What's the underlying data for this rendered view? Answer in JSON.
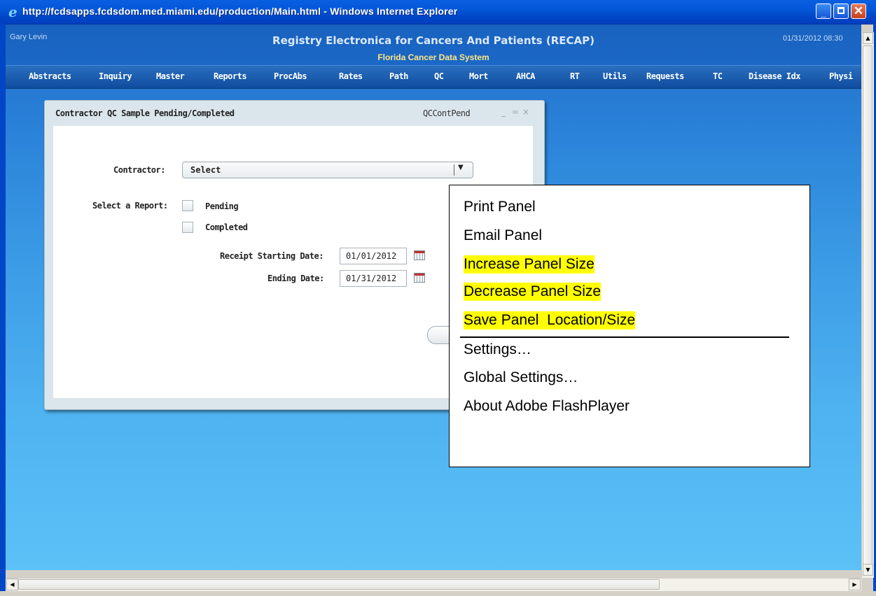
{
  "window": {
    "title": "http://fcdsapps.fcdsdom.med.miami.edu/production/Main.html - Windows Internet Explorer",
    "minimize_glyph": "_",
    "close_glyph": "✕"
  },
  "app": {
    "user": "Gary Levin",
    "title": "Registry Electronica for Cancers And Patients (RECAP)",
    "subtitle": "Florida Cancer Data System",
    "datetime": "01/31/2012 08:30"
  },
  "menu": {
    "items": [
      "Abstracts",
      "Inquiry",
      "Master",
      "Reports",
      "ProcAbs",
      "Rates",
      "Path",
      "QC",
      "Mort",
      "AHCA",
      "RT",
      "Utils",
      "Requests",
      "TC",
      "Disease Idx",
      "Physi"
    ]
  },
  "panel": {
    "title": "Contractor QC Sample Pending/Completed",
    "id": "QCContPend",
    "controls": [
      "_",
      "=",
      "×"
    ],
    "contractor_label": "Contractor:",
    "contractor_value": "Select",
    "select_report_label": "Select a Report:",
    "options": [
      "Pending",
      "Completed"
    ],
    "receipt_start_label": "Receipt Starting Date:",
    "receipt_start_value": "01/01/2012",
    "ending_label": "Ending Date:",
    "ending_value": "01/31/2012"
  },
  "context_menu": {
    "items": [
      {
        "label": "Print Panel",
        "highlight": false
      },
      {
        "label": "Email Panel",
        "highlight": false
      },
      {
        "label": "Increase Panel Size",
        "highlight": true
      },
      {
        "label": "Decrease Panel Size",
        "highlight": true
      },
      {
        "label": "Save Panel  Location/Size",
        "highlight": true
      },
      {
        "label": "Settings…",
        "highlight": false
      },
      {
        "label": "Global Settings…",
        "highlight": false
      },
      {
        "label": "About Adobe FlashPlayer",
        "highlight": false
      }
    ]
  },
  "colors": {
    "title_bar": "#0457d8",
    "menu_bar": "#1b5bb0",
    "highlight": "#ffff00",
    "subtitle": "#ffe680"
  }
}
